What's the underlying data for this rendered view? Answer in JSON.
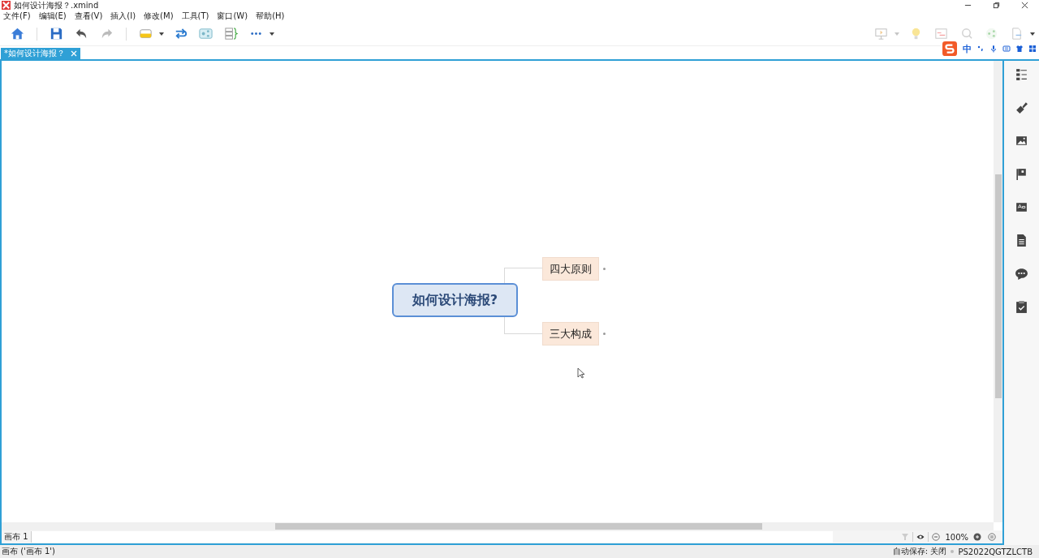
{
  "window": {
    "title": "如何设计海报？.xmind"
  },
  "menu": [
    "文件(F)",
    "编辑(E)",
    "查看(V)",
    "插入(I)",
    "修改(M)",
    "工具(T)",
    "窗口(W)",
    "帮助(H)"
  ],
  "tabs": [
    {
      "label": "*如何设计海报？",
      "selected": true
    }
  ],
  "map": {
    "central": "如何设计海报?",
    "children": [
      {
        "label": "四大原则"
      },
      {
        "label": "三大构成"
      }
    ]
  },
  "ime": {
    "mode": "中"
  },
  "sheet_bar": {
    "sheets": [
      {
        "label": "画布 1",
        "selected": true
      }
    ],
    "zoom": "100%"
  },
  "status_bar": {
    "left": "画布 ('画布 1')",
    "autosave": "自动保存: 关闭",
    "user": "PS2022QGTZLCTB"
  }
}
